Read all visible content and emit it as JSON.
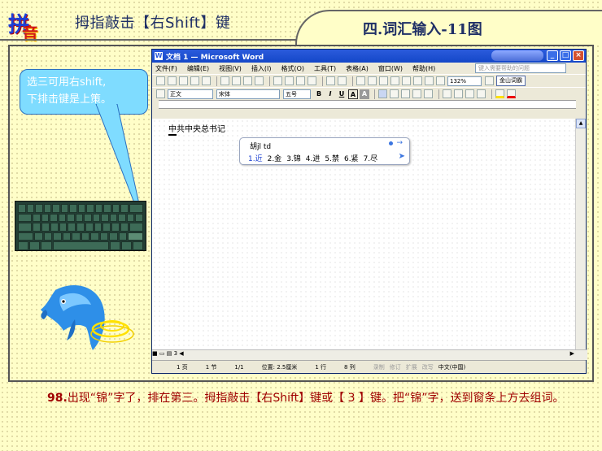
{
  "header": {
    "logo_chars": [
      "拼",
      "音"
    ],
    "title": "拇指敲击【右Shift】键",
    "section_title": "四.词汇输入-11图"
  },
  "callout": {
    "line1": "选三可用右shift,",
    "line2": "下排击键是上策。"
  },
  "word": {
    "window_title": "文档 1 — Microsoft Word",
    "window_buttons": [
      "_",
      "□",
      "×"
    ],
    "menus": [
      "文件(F)",
      "编辑(E)",
      "视图(V)",
      "插入(I)",
      "格式(O)",
      "工具(T)",
      "表格(A)",
      "窗口(W)",
      "帮助(H)"
    ],
    "help_placeholder": "键入需要帮助的问题",
    "zoom": "132%",
    "jinshan_label": "金山词霸",
    "style_value": "正文",
    "font_value": "宋体",
    "size_value": "五号",
    "format_buttons": [
      "B",
      "I",
      "U",
      "A",
      "A"
    ],
    "doc_text": "中共中央总书记",
    "ime": {
      "input": "胡jl td",
      "candidates": [
        "1.近",
        "2.金",
        "3.锦",
        "4.进",
        "5.禁",
        "6.紧",
        "7.尽"
      ],
      "selected_index": 0
    },
    "hscroll_buttons": [
      "■",
      "▭",
      "▤",
      "3",
      "◀",
      "▶"
    ],
    "status": {
      "page": "1 页",
      "section": "1 节",
      "pages": "1/1",
      "position": "位置: 2.5厘米",
      "line": "1 行",
      "column": "8 列",
      "rec": "录制",
      "trk": "修订",
      "ext": "扩展",
      "ovr": "改写",
      "lang": "中文(中国)"
    }
  },
  "caption": {
    "number": "98.",
    "text": "出现“锦”字了，排在第三。拇指敲击【右Shift】键或【 3 】键。把“锦”字，送到窗条上方去组词。"
  },
  "colors": {
    "background": "#fffec8",
    "caption": "#a00000",
    "title_text": "#1f2f66",
    "callout_bg": "#7fdcff",
    "word_titlebar": "#1447c8"
  }
}
